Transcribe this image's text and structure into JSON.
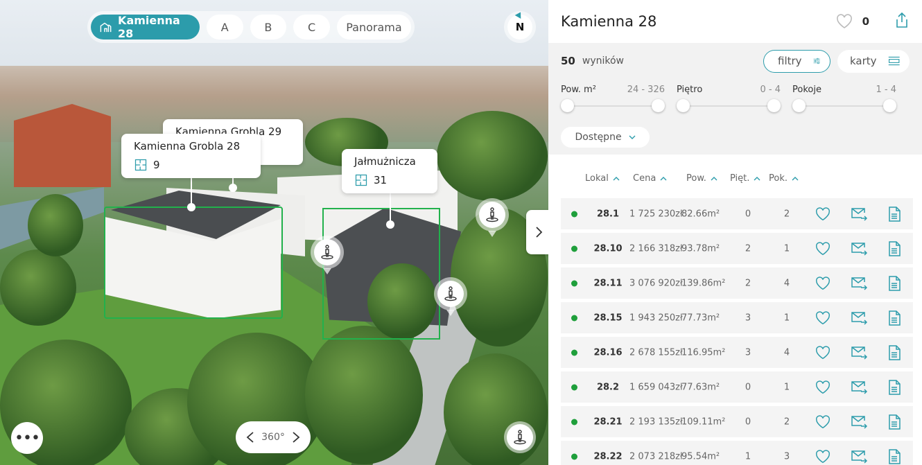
{
  "scene": {
    "tabs": [
      {
        "label": "Kamienna 28",
        "active": true
      },
      {
        "label": "A",
        "active": false
      },
      {
        "label": "B",
        "active": false
      },
      {
        "label": "C",
        "active": false
      },
      {
        "label": "Panorama",
        "active": false
      }
    ],
    "compass_label": "N",
    "buildings": [
      {
        "name": "Kamienna Grobla 29",
        "count": ""
      },
      {
        "name": "Kamienna Grobla 28",
        "count": "9"
      },
      {
        "name": "Jałmużnicza",
        "count": "31"
      }
    ],
    "rotate_label": "360°",
    "more_icon": "ellipsis-icon",
    "accent": "#2c9cab"
  },
  "panel": {
    "title": "Kamienna 28",
    "favorites_count": "0",
    "results_count": "50",
    "results_label": "wyników",
    "filters_label": "filtry",
    "cards_label": "karty",
    "ranges": [
      {
        "label": "Pow. m²",
        "value": "24 - 326"
      },
      {
        "label": "Piętro",
        "value": "0 - 4"
      },
      {
        "label": "Pokoje",
        "value": "1 - 4"
      }
    ],
    "availability": "Dostępne",
    "columns": [
      "Lokal",
      "Cena",
      "Pow.",
      "Pięt.",
      "Pok."
    ],
    "rows": [
      {
        "lokal": "28.1",
        "cena": "1 725 230zł",
        "pow": "82.66m²",
        "pietro": "0",
        "pokoje": "2"
      },
      {
        "lokal": "28.10",
        "cena": "2 166 318zł",
        "pow": "93.78m²",
        "pietro": "2",
        "pokoje": "1"
      },
      {
        "lokal": "28.11",
        "cena": "3 076 920zł",
        "pow": "139.86m²",
        "pietro": "2",
        "pokoje": "4"
      },
      {
        "lokal": "28.15",
        "cena": "1 943 250zł",
        "pow": "77.73m²",
        "pietro": "3",
        "pokoje": "1"
      },
      {
        "lokal": "28.16",
        "cena": "2 678 155zł",
        "pow": "116.95m²",
        "pietro": "3",
        "pokoje": "4"
      },
      {
        "lokal": "28.2",
        "cena": "1 659 043zł",
        "pow": "77.63m²",
        "pietro": "0",
        "pokoje": "1"
      },
      {
        "lokal": "28.21",
        "cena": "2 193 135zł",
        "pow": "109.11m²",
        "pietro": "0",
        "pokoje": "2"
      },
      {
        "lokal": "28.22",
        "cena": "2 073 218zł",
        "pow": "95.54m²",
        "pietro": "1",
        "pokoje": "3"
      }
    ],
    "status_color": "#1f9f3b"
  }
}
